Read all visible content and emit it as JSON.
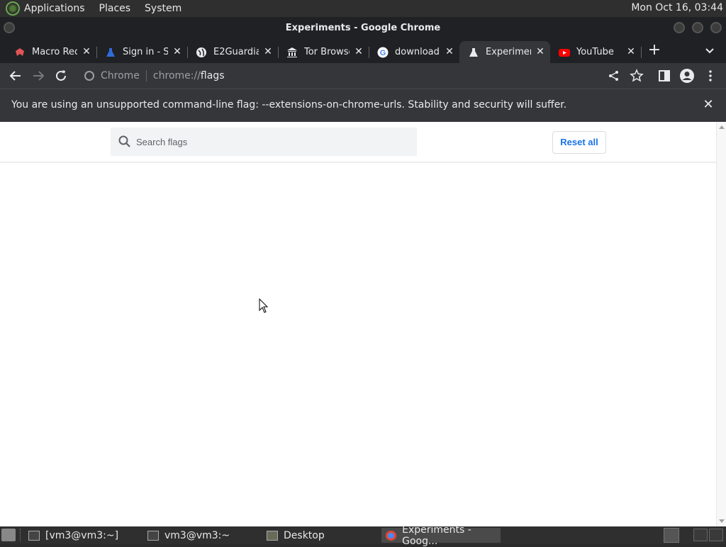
{
  "top_panel": {
    "menus": [
      "Applications",
      "Places",
      "System"
    ],
    "clock": "Mon Oct 16, 03:44"
  },
  "window": {
    "title": "Experiments - Google Chrome"
  },
  "tabs": [
    {
      "label": "Macro Recc",
      "icon": "macro-recorder-icon",
      "active": false
    },
    {
      "label": "Sign in - Se",
      "icon": "flask-icon",
      "active": false
    },
    {
      "label": "E2Guardian",
      "icon": "globe-icon",
      "active": false
    },
    {
      "label": "Tor Browse",
      "icon": "tor-building-icon",
      "active": false
    },
    {
      "label": "download",
      "icon": "google-icon",
      "active": false
    },
    {
      "label": "Experimen",
      "icon": "flask-icon",
      "active": true
    },
    {
      "label": "YouTube",
      "icon": "youtube-icon",
      "active": false
    }
  ],
  "omnibox": {
    "chip": "Chrome",
    "url_scheme": "chrome://",
    "url_path": "flags"
  },
  "infobar": {
    "message": "You are using an unsupported command-line flag: --extensions-on-chrome-urls. Stability and security will suffer."
  },
  "flags_page": {
    "search_placeholder": "Search flags",
    "reset_label": "Reset all"
  },
  "taskbar": {
    "items": [
      {
        "label": "[vm3@vm3:~]",
        "icon": "terminal-icon",
        "active": false
      },
      {
        "label": "vm3@vm3:~",
        "icon": "terminal-icon",
        "active": false
      },
      {
        "label": "Desktop",
        "icon": "folder-icon",
        "active": false
      },
      {
        "label": "Experiments - Goog...",
        "icon": "chrome-icon",
        "active": true
      }
    ]
  },
  "colors": {
    "accent_blue": "#1a73e8",
    "chrome_dark": "#202124",
    "toolbar": "#35363a",
    "youtube_red": "#ff0000"
  }
}
